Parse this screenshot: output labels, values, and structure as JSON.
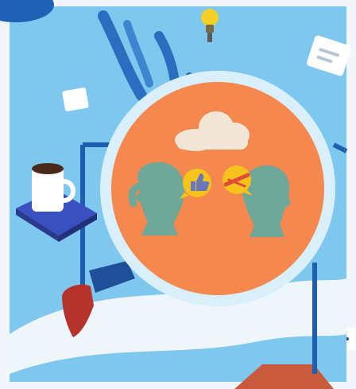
{
  "illustration": {
    "palette": {
      "sky": "#7ec8f0",
      "accent_blue": "#1f62b5",
      "ring": "#d9f0fb",
      "orange": "#f5884f",
      "cloud": "#f4e6d6",
      "figure": "#6fa799",
      "bubble": "#f6c21c",
      "thumb": "#6a78b8",
      "dislike": "#e24a3a",
      "book": "#3a4fc0",
      "shoe": "#b5332d",
      "wave": "#eef5fb",
      "bulb": "#f4d028"
    },
    "icons": [
      "cloud-icon",
      "thumbs-up-icon",
      "dislike-icon",
      "lightbulb-icon",
      "coffee-mug-icon",
      "book-icon",
      "shoe-icon",
      "chat-bubble-icon"
    ]
  }
}
